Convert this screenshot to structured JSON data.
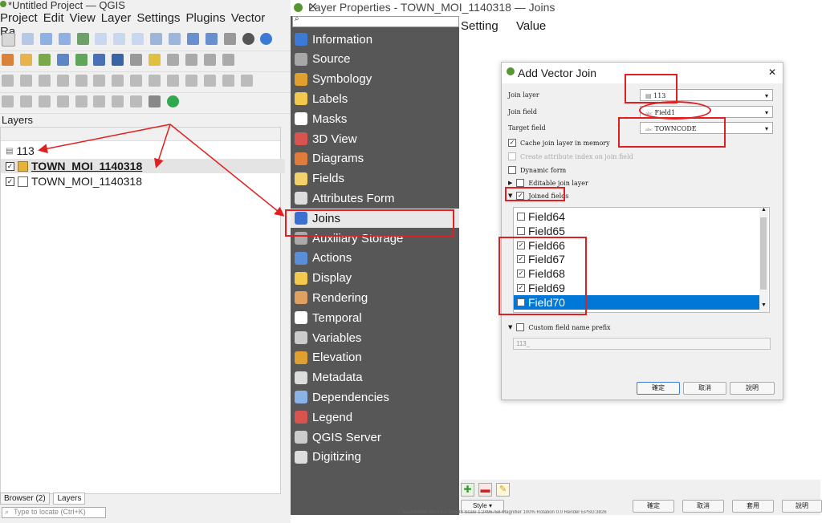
{
  "qgis": {
    "title": "*Untitled Project — QGIS",
    "menu": [
      "Project",
      "Edit",
      "View",
      "Layer",
      "Settings",
      "Plugins",
      "Vector",
      "Ra"
    ],
    "layers_title": "Layers",
    "layers": [
      {
        "name": "113",
        "checked": false
      },
      {
        "name": "TOWN_MOI_1140318",
        "checked": true
      },
      {
        "name": "TOWN_MOI_1140318",
        "checked": true
      }
    ],
    "bottom_tabs": [
      "Browser (2)",
      "Layers"
    ],
    "locate_placeholder": "Type to locate (Ctrl+K)"
  },
  "layer_props": {
    "title": "Layer Properties - TOWN_MOI_1140318 — Joins",
    "nav": [
      {
        "label": "Information",
        "icon": "info-icon",
        "color": "#3b7bd6"
      },
      {
        "label": "Source",
        "icon": "gear-icon",
        "color": "#a7a7a7"
      },
      {
        "label": "Symbology",
        "icon": "paintbrush-icon",
        "color": "#e0a030"
      },
      {
        "label": "Labels",
        "icon": "labels-icon",
        "color": "#f2c94c"
      },
      {
        "label": "Masks",
        "icon": "masks-icon",
        "color": "#ffffff"
      },
      {
        "label": "3D View",
        "icon": "cube-icon",
        "color": "#d9534f"
      },
      {
        "label": "Diagrams",
        "icon": "diagram-icon",
        "color": "#e07b39"
      },
      {
        "label": "Fields",
        "icon": "fields-icon",
        "color": "#f2d16b"
      },
      {
        "label": "Attributes Form",
        "icon": "form-icon",
        "color": "#dddddd"
      },
      {
        "label": "Joins",
        "icon": "join-icon",
        "color": "#3b6fd0"
      },
      {
        "label": "Auxiliary Storage",
        "icon": "storage-icon",
        "color": "#aaaaaa"
      },
      {
        "label": "Actions",
        "icon": "actions-icon",
        "color": "#5a8fd8"
      },
      {
        "label": "Display",
        "icon": "display-icon",
        "color": "#f2c94c"
      },
      {
        "label": "Rendering",
        "icon": "rendering-icon",
        "color": "#e0a060"
      },
      {
        "label": "Temporal",
        "icon": "clock-icon",
        "color": "#ffffff"
      },
      {
        "label": "Variables",
        "icon": "variables-icon",
        "color": "#cccccc"
      },
      {
        "label": "Elevation",
        "icon": "elevation-icon",
        "color": "#e0a030"
      },
      {
        "label": "Metadata",
        "icon": "metadata-icon",
        "color": "#dddddd"
      },
      {
        "label": "Dependencies",
        "icon": "dependencies-icon",
        "color": "#8ab4e8"
      },
      {
        "label": "Legend",
        "icon": "legend-icon",
        "color": "#d9534f"
      },
      {
        "label": "QGIS Server",
        "icon": "server-icon",
        "color": "#cccccc"
      },
      {
        "label": "Digitizing",
        "icon": "digitizing-icon",
        "color": "#dddddd"
      }
    ],
    "active_index": 9,
    "table_headers": [
      "Setting",
      "Value"
    ],
    "footer": {
      "style_label": "Style",
      "buttons": [
        "確定",
        "取消",
        "套用",
        "說明"
      ]
    },
    "status": {
      "coordinate_label": "Coordinate",
      "coordinate": "-85714,2724548",
      "scale_label": "Scale",
      "scale": "1:2496758",
      "magnifier_label": "Magnifier",
      "magnifier": "100%",
      "rotation_label": "Rotation",
      "rotation": "0.0",
      "render_label": "Render",
      "crs": "EPSG:3826"
    }
  },
  "vector_join": {
    "title": "Add Vector Join",
    "join_layer_label": "Join layer",
    "join_layer": "113",
    "join_field_label": "Join field",
    "join_field": "Field1",
    "target_field_label": "Target field",
    "target_field": "TOWNCODE",
    "cache_label": "Cache join layer in memory",
    "index_label": "Create attribute index on join field",
    "dynamic_label": "Dynamic form",
    "editable_label": "Editable join layer",
    "joined_fields_label": "Joined fields",
    "fields": [
      {
        "name": "Field64",
        "checked": false
      },
      {
        "name": "Field65",
        "checked": false
      },
      {
        "name": "Field66",
        "checked": true
      },
      {
        "name": "Field67",
        "checked": true
      },
      {
        "name": "Field68",
        "checked": true
      },
      {
        "name": "Field69",
        "checked": true
      },
      {
        "name": "Field70",
        "checked": true
      }
    ],
    "selected_field": 6,
    "prefix_label": "Custom field name prefix",
    "prefix_value": "113_",
    "buttons": {
      "ok": "確定",
      "cancel": "取消",
      "help": "說明"
    }
  },
  "colors": {
    "annotation_red": "#e02020",
    "selection_blue": "#0078d7",
    "sidebar_bg": "#575757"
  }
}
